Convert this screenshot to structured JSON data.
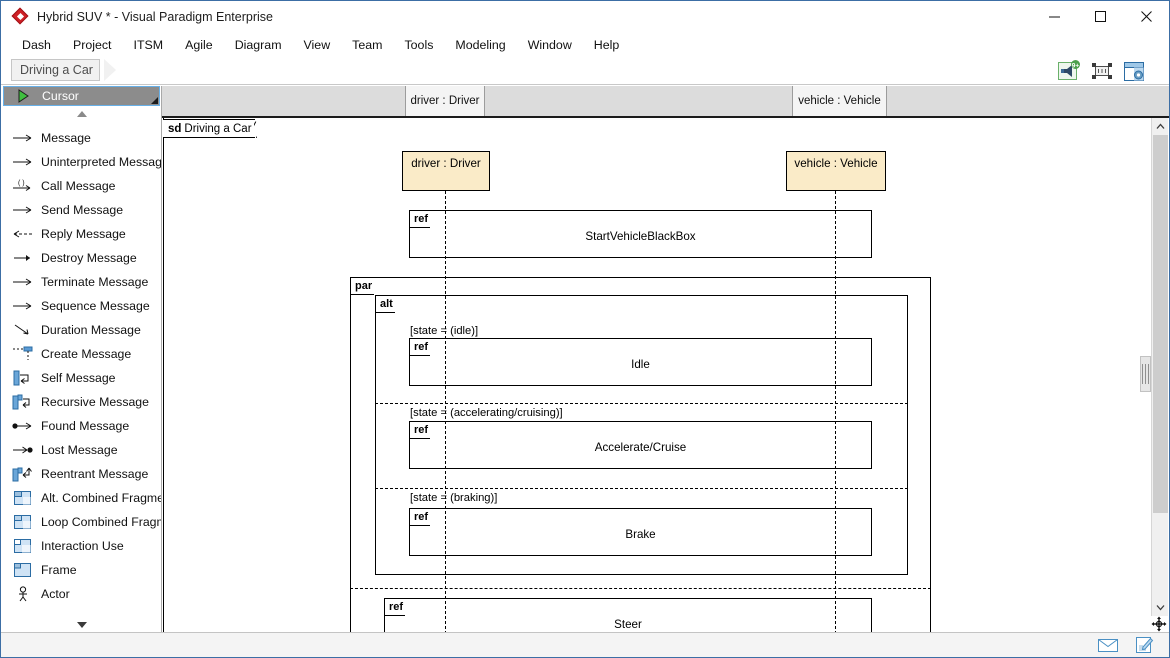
{
  "window": {
    "title": "Hybrid SUV * - Visual Paradigm Enterprise",
    "logo_icon": "visual-paradigm-diamond-logo",
    "minimize_label": "minimize-icon",
    "maximize_label": "maximize-icon",
    "close_label": "close-icon"
  },
  "menubar": {
    "items": [
      {
        "label": "Dash"
      },
      {
        "label": "Project"
      },
      {
        "label": "ITSM"
      },
      {
        "label": "Agile"
      },
      {
        "label": "Diagram"
      },
      {
        "label": "View"
      },
      {
        "label": "Team"
      },
      {
        "label": "Tools"
      },
      {
        "label": "Modeling"
      },
      {
        "label": "Window"
      },
      {
        "label": "Help"
      }
    ]
  },
  "breadcrumb": {
    "label": "Driving a Car"
  },
  "toolbar": {
    "icons": [
      {
        "name": "megaphone-notification-icon",
        "badge": "9+"
      },
      {
        "name": "fit-to-screen-icon",
        "badge": ""
      },
      {
        "name": "panel-layout-icon",
        "badge": ""
      }
    ]
  },
  "palette": {
    "header": {
      "label": "Cursor",
      "icon": "cursor-arrow-icon"
    },
    "scroll_up_icon": "scroll-up-triangle-icon",
    "scroll_down_icon": "scroll-down-triangle-icon",
    "items": [
      {
        "label": "Message",
        "icon": "message-arrow-icon"
      },
      {
        "label": "Uninterpreted Message",
        "icon": "uninterpreted-message-icon"
      },
      {
        "label": "Call Message",
        "icon": "call-message-icon"
      },
      {
        "label": "Send Message",
        "icon": "send-message-icon"
      },
      {
        "label": "Reply Message",
        "icon": "reply-message-icon"
      },
      {
        "label": "Destroy Message",
        "icon": "destroy-message-icon"
      },
      {
        "label": "Terminate Message",
        "icon": "terminate-message-icon"
      },
      {
        "label": "Sequence Message",
        "icon": "sequence-message-icon"
      },
      {
        "label": "Duration Message",
        "icon": "duration-message-icon"
      },
      {
        "label": "Create Message",
        "icon": "create-message-icon"
      },
      {
        "label": "Self Message",
        "icon": "self-message-icon"
      },
      {
        "label": "Recursive Message",
        "icon": "recursive-message-icon"
      },
      {
        "label": "Found Message",
        "icon": "found-message-icon"
      },
      {
        "label": "Lost Message",
        "icon": "lost-message-icon"
      },
      {
        "label": "Reentrant Message",
        "icon": "reentrant-message-icon"
      },
      {
        "label": "Alt. Combined Fragment",
        "icon": "alt-combined-fragment-icon"
      },
      {
        "label": "Loop Combined Fragment",
        "icon": "loop-combined-fragment-icon"
      },
      {
        "label": "Interaction Use",
        "icon": "interaction-use-icon"
      },
      {
        "label": "Frame",
        "icon": "frame-icon"
      },
      {
        "label": "Actor",
        "icon": "actor-icon"
      }
    ]
  },
  "lifeline_header": {
    "tabs": [
      {
        "label": "driver : Driver"
      },
      {
        "label": "vehicle : Vehicle"
      }
    ]
  },
  "diagram": {
    "frame_keyword": "sd",
    "frame_name": "Driving a Car",
    "lifelines": [
      {
        "label": "driver : Driver"
      },
      {
        "label": "vehicle : Vehicle"
      }
    ],
    "refs": [
      {
        "keyword": "ref",
        "label": "StartVehicleBlackBox"
      },
      {
        "keyword": "ref",
        "label": "Idle"
      },
      {
        "keyword": "ref",
        "label": "Accelerate/Cruise"
      },
      {
        "keyword": "ref",
        "label": "Brake"
      },
      {
        "keyword": "ref",
        "label": "Steer"
      }
    ],
    "fragments": [
      {
        "keyword": "par"
      },
      {
        "keyword": "alt"
      }
    ],
    "guards": [
      {
        "label": "[state = (idle)]"
      },
      {
        "label": "[state = (accelerating/cruising)]"
      },
      {
        "label": "[state = (braking)]"
      }
    ]
  },
  "scrollbar": {
    "up_icon": "scroll-up-chevron-icon",
    "down_icon": "scroll-down-chevron-icon",
    "pan_icon": "pan-move-icon"
  },
  "statusbar": {
    "icons": [
      {
        "name": "mail-envelope-icon"
      },
      {
        "name": "note-edit-icon"
      }
    ]
  },
  "colors": {
    "lifeline_fill": "#faebc8",
    "selection_blue": "#67b0e8",
    "palette_selected": "#8c8c8c",
    "accent_red": "#cf2026"
  }
}
